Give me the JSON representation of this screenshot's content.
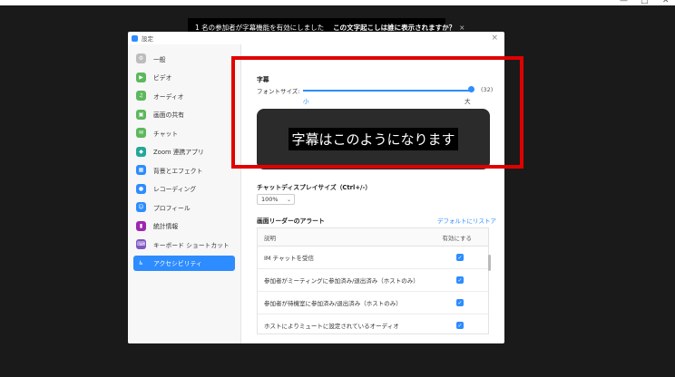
{
  "notification": {
    "message": "1 名の参加者が字幕機能を有効にしました",
    "question": "この文字起こしは誰に表示されますか？",
    "close": "×"
  },
  "dialog": {
    "title": "設定",
    "close": "×"
  },
  "sidebar": {
    "items": [
      {
        "label": "一般",
        "icon": "gear-icon",
        "color": "#bdbdbd"
      },
      {
        "label": "ビデオ",
        "icon": "video-icon",
        "color": "#5cb85c"
      },
      {
        "label": "オーディオ",
        "icon": "headphones-icon",
        "color": "#5cb85c"
      },
      {
        "label": "画面の共有",
        "icon": "screen-share-icon",
        "color": "#5cb85c"
      },
      {
        "label": "チャット",
        "icon": "chat-icon",
        "color": "#5cb85c"
      },
      {
        "label": "Zoom 連携アプリ",
        "icon": "apps-icon",
        "color": "#26a69a"
      },
      {
        "label": "背景とエフェクト",
        "icon": "background-icon",
        "color": "#2d8cff"
      },
      {
        "label": "レコーディング",
        "icon": "record-icon",
        "color": "#2d8cff"
      },
      {
        "label": "プロフィール",
        "icon": "profile-icon",
        "color": "#2d8cff"
      },
      {
        "label": "統計情報",
        "icon": "stats-icon",
        "color": "#9c27b0"
      },
      {
        "label": "キーボード ショートカット",
        "icon": "keyboard-icon",
        "color": "#7e57c2"
      },
      {
        "label": "アクセシビリティ",
        "icon": "accessibility-icon",
        "color": "#2d8cff",
        "active": true
      }
    ]
  },
  "captions": {
    "section_label": "字幕",
    "font_size_label": "フォントサイズ:",
    "font_size_value": "(32)",
    "slider_level": 0.98,
    "min_label": "小",
    "max_label": "大",
    "preview_text": "字幕はこのようになります"
  },
  "chat_display": {
    "label": "チャットディスプレイサイズ（Ctrl+/-）",
    "value": "100%"
  },
  "screen_reader": {
    "label": "画面リーダーのアラート",
    "reset": "デフォルトにリストア",
    "header_description": "説明",
    "header_enable": "有効にする",
    "rows": [
      {
        "label": "IM チャットを受信",
        "checked": true
      },
      {
        "label": "参加者がミーティングに参加済み/退出済み（ホストのみ）",
        "checked": true
      },
      {
        "label": "参加者が待機室に参加済み/退出済み（ホストのみ）",
        "checked": true
      },
      {
        "label": "ホストによりミュートに設定されているオーディオ",
        "checked": true
      }
    ]
  },
  "colors": {
    "accent": "#2d8cff",
    "highlight": "#e00000"
  }
}
